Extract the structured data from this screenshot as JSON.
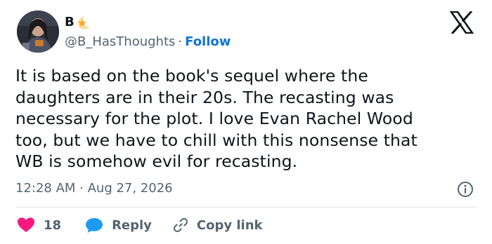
{
  "author": {
    "display_name": "B",
    "handle": "@B_HasThoughts",
    "separator": "·",
    "follow_label": "Follow",
    "badge_icon": "star-crescent-icon"
  },
  "tweet": {
    "text_lines": [
      "It is based on the book's sequel where the",
      "daughters are in their 20s. The recasting was",
      "necessary for the plot. I love Evan Rachel Wood",
      "too, but we have to chill with this nonsense that",
      "WB is somehow evil for recasting."
    ],
    "timestamp": "12:28 AM · Aug 27, 2026"
  },
  "actions": {
    "like_count": "18",
    "reply_label": "Reply",
    "copy_link_label": "Copy link"
  },
  "colors": {
    "text": "#0f1419",
    "secondary": "#536471",
    "link_blue": "#0f74d6",
    "heart": "#f91880",
    "reply_blue": "#1d9bf0",
    "divider": "#dfe4e8"
  },
  "icons": {
    "logo": "x-logo-icon",
    "info": "info-icon",
    "like": "heart-icon",
    "reply": "speech-bubble-icon",
    "copy": "link-icon"
  }
}
